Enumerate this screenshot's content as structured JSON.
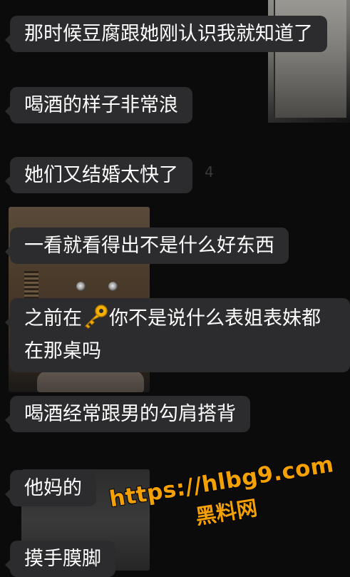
{
  "messages": [
    {
      "text": "那时候豆腐跟她刚认识我就知道了"
    },
    {
      "text": "喝酒的样子非常浪"
    },
    {
      "text": "她们又结婚太快了"
    },
    {
      "text": "一看就看得出不是什么好东西"
    },
    {
      "text_before": "之前在",
      "icon": "key-emoji",
      "text_after": "你不是说什么表姐表妹都在那桌吗"
    },
    {
      "text": "喝酒经常跟男的勾肩搭背"
    },
    {
      "text": "他妈的"
    },
    {
      "text": "摸手膜脚"
    }
  ],
  "background": {
    "faint_text": "4"
  },
  "watermark": {
    "url": "https://hlbg9.com",
    "name": "黑料网"
  },
  "colors": {
    "bubble": "#2c2c2e",
    "text": "#ffffff",
    "watermark": "#f4a100"
  }
}
